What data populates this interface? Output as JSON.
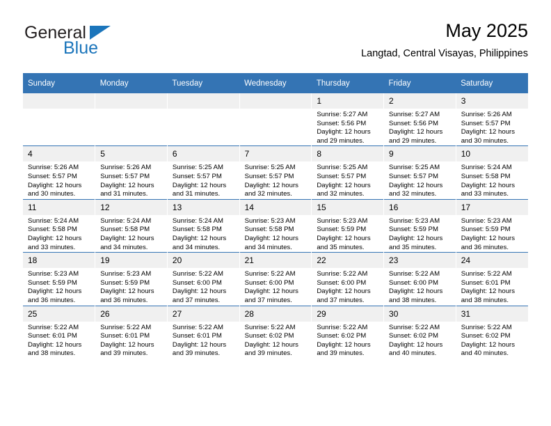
{
  "logo": {
    "line1": "General",
    "line2": "Blue",
    "triangle_icon": "triangle-icon",
    "colors": {
      "text": "#231f20",
      "accent": "#1b75bb"
    }
  },
  "header": {
    "title": "May 2025",
    "subtitle": "Langtad, Central Visayas, Philippines"
  },
  "theme": {
    "header_bg": "#3474b4",
    "daynum_bg": "#f0f0f0",
    "text": "#000000"
  },
  "weekdays": [
    "Sunday",
    "Monday",
    "Tuesday",
    "Wednesday",
    "Thursday",
    "Friday",
    "Saturday"
  ],
  "weeks": [
    [
      {
        "day": "",
        "empty": true
      },
      {
        "day": "",
        "empty": true
      },
      {
        "day": "",
        "empty": true
      },
      {
        "day": "",
        "empty": true
      },
      {
        "day": "1",
        "sunrise": "Sunrise: 5:27 AM",
        "sunset": "Sunset: 5:56 PM",
        "daylight1": "Daylight: 12 hours",
        "daylight2": "and 29 minutes."
      },
      {
        "day": "2",
        "sunrise": "Sunrise: 5:27 AM",
        "sunset": "Sunset: 5:56 PM",
        "daylight1": "Daylight: 12 hours",
        "daylight2": "and 29 minutes."
      },
      {
        "day": "3",
        "sunrise": "Sunrise: 5:26 AM",
        "sunset": "Sunset: 5:57 PM",
        "daylight1": "Daylight: 12 hours",
        "daylight2": "and 30 minutes."
      }
    ],
    [
      {
        "day": "4",
        "sunrise": "Sunrise: 5:26 AM",
        "sunset": "Sunset: 5:57 PM",
        "daylight1": "Daylight: 12 hours",
        "daylight2": "and 30 minutes."
      },
      {
        "day": "5",
        "sunrise": "Sunrise: 5:26 AM",
        "sunset": "Sunset: 5:57 PM",
        "daylight1": "Daylight: 12 hours",
        "daylight2": "and 31 minutes."
      },
      {
        "day": "6",
        "sunrise": "Sunrise: 5:25 AM",
        "sunset": "Sunset: 5:57 PM",
        "daylight1": "Daylight: 12 hours",
        "daylight2": "and 31 minutes."
      },
      {
        "day": "7",
        "sunrise": "Sunrise: 5:25 AM",
        "sunset": "Sunset: 5:57 PM",
        "daylight1": "Daylight: 12 hours",
        "daylight2": "and 32 minutes."
      },
      {
        "day": "8",
        "sunrise": "Sunrise: 5:25 AM",
        "sunset": "Sunset: 5:57 PM",
        "daylight1": "Daylight: 12 hours",
        "daylight2": "and 32 minutes."
      },
      {
        "day": "9",
        "sunrise": "Sunrise: 5:25 AM",
        "sunset": "Sunset: 5:57 PM",
        "daylight1": "Daylight: 12 hours",
        "daylight2": "and 32 minutes."
      },
      {
        "day": "10",
        "sunrise": "Sunrise: 5:24 AM",
        "sunset": "Sunset: 5:58 PM",
        "daylight1": "Daylight: 12 hours",
        "daylight2": "and 33 minutes."
      }
    ],
    [
      {
        "day": "11",
        "sunrise": "Sunrise: 5:24 AM",
        "sunset": "Sunset: 5:58 PM",
        "daylight1": "Daylight: 12 hours",
        "daylight2": "and 33 minutes."
      },
      {
        "day": "12",
        "sunrise": "Sunrise: 5:24 AM",
        "sunset": "Sunset: 5:58 PM",
        "daylight1": "Daylight: 12 hours",
        "daylight2": "and 34 minutes."
      },
      {
        "day": "13",
        "sunrise": "Sunrise: 5:24 AM",
        "sunset": "Sunset: 5:58 PM",
        "daylight1": "Daylight: 12 hours",
        "daylight2": "and 34 minutes."
      },
      {
        "day": "14",
        "sunrise": "Sunrise: 5:23 AM",
        "sunset": "Sunset: 5:58 PM",
        "daylight1": "Daylight: 12 hours",
        "daylight2": "and 34 minutes."
      },
      {
        "day": "15",
        "sunrise": "Sunrise: 5:23 AM",
        "sunset": "Sunset: 5:59 PM",
        "daylight1": "Daylight: 12 hours",
        "daylight2": "and 35 minutes."
      },
      {
        "day": "16",
        "sunrise": "Sunrise: 5:23 AM",
        "sunset": "Sunset: 5:59 PM",
        "daylight1": "Daylight: 12 hours",
        "daylight2": "and 35 minutes."
      },
      {
        "day": "17",
        "sunrise": "Sunrise: 5:23 AM",
        "sunset": "Sunset: 5:59 PM",
        "daylight1": "Daylight: 12 hours",
        "daylight2": "and 36 minutes."
      }
    ],
    [
      {
        "day": "18",
        "sunrise": "Sunrise: 5:23 AM",
        "sunset": "Sunset: 5:59 PM",
        "daylight1": "Daylight: 12 hours",
        "daylight2": "and 36 minutes."
      },
      {
        "day": "19",
        "sunrise": "Sunrise: 5:23 AM",
        "sunset": "Sunset: 5:59 PM",
        "daylight1": "Daylight: 12 hours",
        "daylight2": "and 36 minutes."
      },
      {
        "day": "20",
        "sunrise": "Sunrise: 5:22 AM",
        "sunset": "Sunset: 6:00 PM",
        "daylight1": "Daylight: 12 hours",
        "daylight2": "and 37 minutes."
      },
      {
        "day": "21",
        "sunrise": "Sunrise: 5:22 AM",
        "sunset": "Sunset: 6:00 PM",
        "daylight1": "Daylight: 12 hours",
        "daylight2": "and 37 minutes."
      },
      {
        "day": "22",
        "sunrise": "Sunrise: 5:22 AM",
        "sunset": "Sunset: 6:00 PM",
        "daylight1": "Daylight: 12 hours",
        "daylight2": "and 37 minutes."
      },
      {
        "day": "23",
        "sunrise": "Sunrise: 5:22 AM",
        "sunset": "Sunset: 6:00 PM",
        "daylight1": "Daylight: 12 hours",
        "daylight2": "and 38 minutes."
      },
      {
        "day": "24",
        "sunrise": "Sunrise: 5:22 AM",
        "sunset": "Sunset: 6:01 PM",
        "daylight1": "Daylight: 12 hours",
        "daylight2": "and 38 minutes."
      }
    ],
    [
      {
        "day": "25",
        "sunrise": "Sunrise: 5:22 AM",
        "sunset": "Sunset: 6:01 PM",
        "daylight1": "Daylight: 12 hours",
        "daylight2": "and 38 minutes."
      },
      {
        "day": "26",
        "sunrise": "Sunrise: 5:22 AM",
        "sunset": "Sunset: 6:01 PM",
        "daylight1": "Daylight: 12 hours",
        "daylight2": "and 39 minutes."
      },
      {
        "day": "27",
        "sunrise": "Sunrise: 5:22 AM",
        "sunset": "Sunset: 6:01 PM",
        "daylight1": "Daylight: 12 hours",
        "daylight2": "and 39 minutes."
      },
      {
        "day": "28",
        "sunrise": "Sunrise: 5:22 AM",
        "sunset": "Sunset: 6:02 PM",
        "daylight1": "Daylight: 12 hours",
        "daylight2": "and 39 minutes."
      },
      {
        "day": "29",
        "sunrise": "Sunrise: 5:22 AM",
        "sunset": "Sunset: 6:02 PM",
        "daylight1": "Daylight: 12 hours",
        "daylight2": "and 39 minutes."
      },
      {
        "day": "30",
        "sunrise": "Sunrise: 5:22 AM",
        "sunset": "Sunset: 6:02 PM",
        "daylight1": "Daylight: 12 hours",
        "daylight2": "and 40 minutes."
      },
      {
        "day": "31",
        "sunrise": "Sunrise: 5:22 AM",
        "sunset": "Sunset: 6:02 PM",
        "daylight1": "Daylight: 12 hours",
        "daylight2": "and 40 minutes."
      }
    ]
  ]
}
